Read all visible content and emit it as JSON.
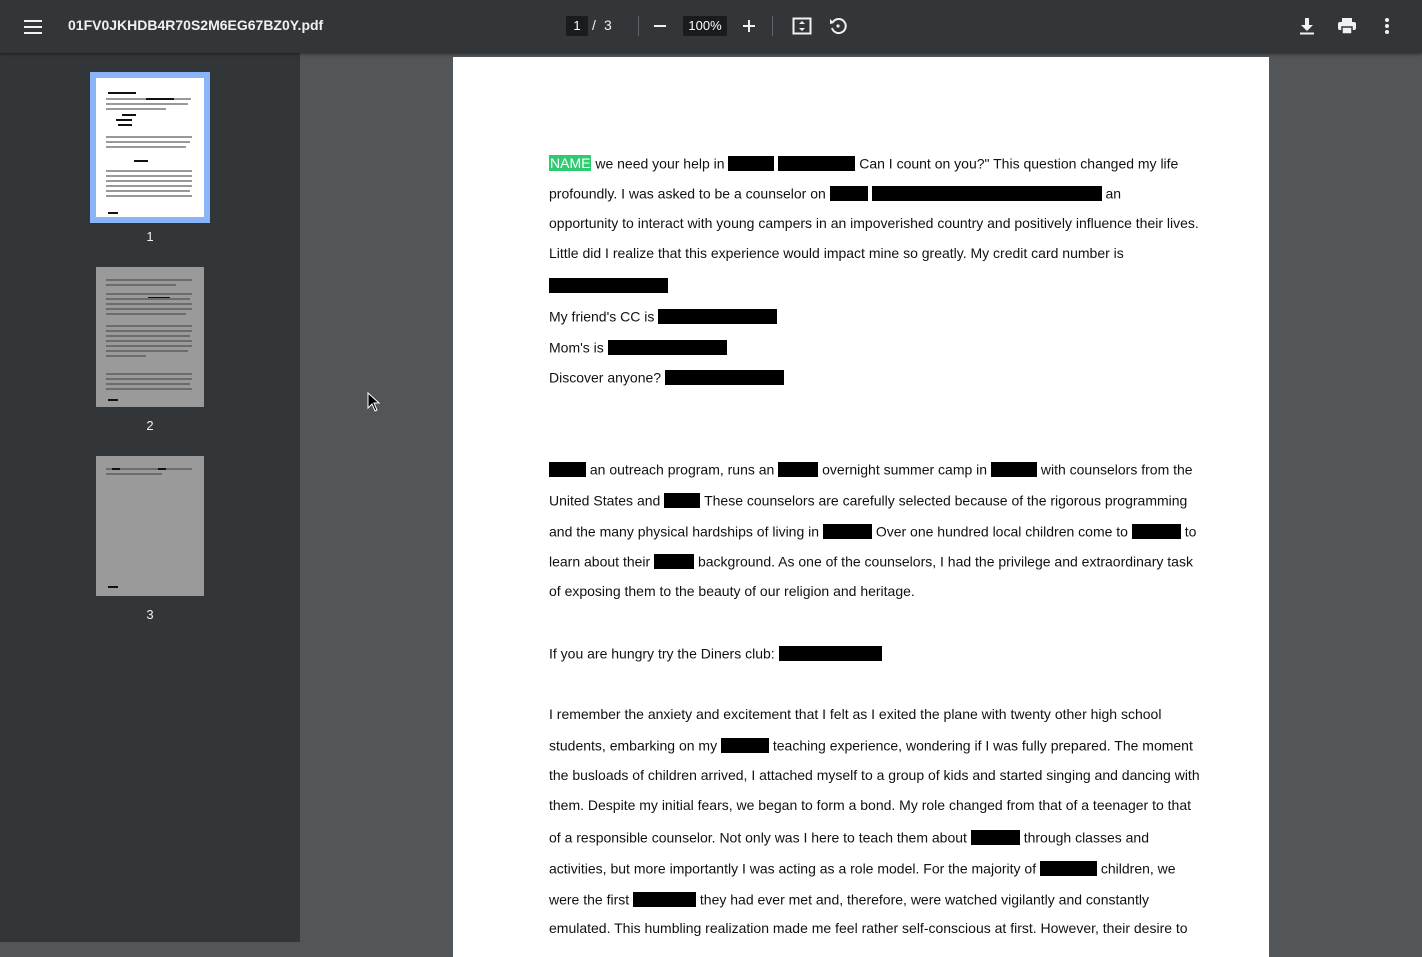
{
  "toolbar": {
    "filename": "01FV0JKHDB4R70S2M6EG67BZ0Y.pdf",
    "current_page": "1",
    "page_separator": "/",
    "total_pages": "3",
    "zoom": "100%"
  },
  "icons": {
    "menu": "menu-icon",
    "zoom_out": "zoom-out-icon",
    "zoom_in": "zoom-in-icon",
    "fit": "fit-to-page-icon",
    "rotate": "rotate-icon",
    "download": "download-icon",
    "print": "print-icon",
    "more": "more-vert-icon"
  },
  "colors": {
    "toolbar": "#323639",
    "viewer_bg": "#525659",
    "accent": "#8ab4f8",
    "highlight": "#2ecc71"
  },
  "thumbnails": [
    {
      "label": "1"
    },
    {
      "label": "2"
    },
    {
      "label": "3"
    }
  ],
  "document": {
    "highlight_label": "NAME",
    "p1": [
      "we need your help in",
      "Can I count on you?\" This question changed my life",
      "profoundly. I was asked to be a counselor on",
      "an",
      "opportunity to interact with young campers in an impoverished country and positively influence their lives.",
      "Little did I realize that this experience would impact mine so greatly. My credit card number is"
    ],
    "cc1": "My friend's CC is",
    "cc2": "Mom's is",
    "cc3": "Discover anyone?",
    "p2": [
      "an outreach program, runs an",
      "overnight summer camp in",
      "with counselors from the",
      "United States and",
      "These counselors are carefully selected because of the rigorous programming",
      "and the many physical hardships of living in",
      "Over one hundred local children come to",
      "to",
      "learn about their",
      "background. As one of the counselors, I had the privilege and extraordinary task",
      "of exposing them to the beauty of our religion and heritage."
    ],
    "diners": "If you are hungry try the Diners club:",
    "p3": [
      "I remember the anxiety and excitement that I felt as I exited the plane with twenty other high school",
      "students, embarking on my",
      "teaching experience, wondering if I was fully prepared. The moment",
      "the busloads of children arrived, I attached myself to a group of kids and started singing and dancing with",
      "them. Despite my initial fears, we began to form a bond. My role changed from that of a teenager to that",
      "of a responsible counselor. Not only was I here to teach them about",
      "through classes and",
      "activities, but more importantly I was acting as a role model. For the majority of",
      "children, we",
      "were the first",
      "they had ever met and, therefore, were watched vigilantly and constantly",
      "emulated. This humbling realization made me feel rather self-conscious at first. However, their desire to"
    ]
  }
}
